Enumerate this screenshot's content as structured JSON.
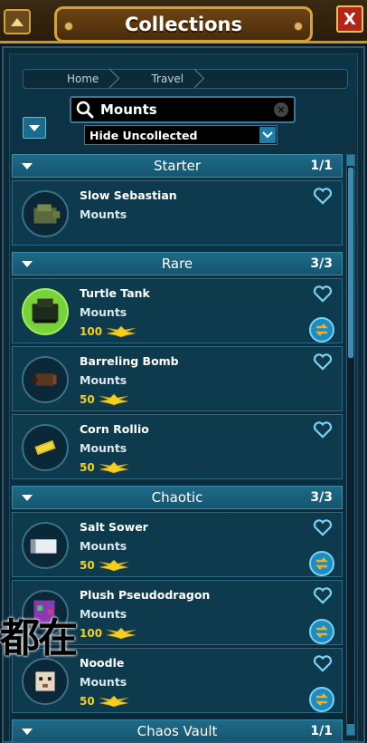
{
  "window": {
    "title": "Collections",
    "close_label": "X"
  },
  "breadcrumb": [
    "Home",
    "Travel"
  ],
  "search": {
    "value": "Mounts"
  },
  "filter": {
    "selected": "Hide Uncollected"
  },
  "sections": [
    {
      "title": "Starter",
      "count": "1/1",
      "items": [
        {
          "name": "Slow Sebastian",
          "category": "Mounts",
          "price": "",
          "swap": false,
          "icon": "turtle-mount-icon",
          "owned": false
        }
      ]
    },
    {
      "title": "Rare",
      "count": "3/3",
      "items": [
        {
          "name": "Turtle Tank",
          "category": "Mounts",
          "price": "100",
          "swap": true,
          "icon": "turtle-tank-icon",
          "owned": true
        },
        {
          "name": "Barreling Bomb",
          "category": "Mounts",
          "price": "50",
          "swap": false,
          "icon": "bomb-mount-icon",
          "owned": false
        },
        {
          "name": "Corn Rollio",
          "category": "Mounts",
          "price": "50",
          "swap": false,
          "icon": "corn-mount-icon",
          "owned": false
        }
      ]
    },
    {
      "title": "Chaotic",
      "count": "3/3",
      "items": [
        {
          "name": "Salt Sower",
          "category": "Mounts",
          "price": "50",
          "swap": true,
          "icon": "salt-shaker-icon",
          "owned": false
        },
        {
          "name": "Plush Pseudodragon",
          "category": "Mounts",
          "price": "100",
          "swap": true,
          "icon": "plush-dragon-icon",
          "owned": false
        },
        {
          "name": "Noodle",
          "category": "Mounts",
          "price": "50",
          "swap": true,
          "icon": "noodle-dog-icon",
          "owned": false
        }
      ]
    },
    {
      "title": "Chaos Vault",
      "count": "1/1",
      "items": []
    }
  ],
  "overlay": {
    "text": "都在"
  },
  "colors": {
    "accent": "#1a8ec4",
    "gold": "#f2d020",
    "frame": "#d4a23a",
    "close": "#b52418"
  }
}
